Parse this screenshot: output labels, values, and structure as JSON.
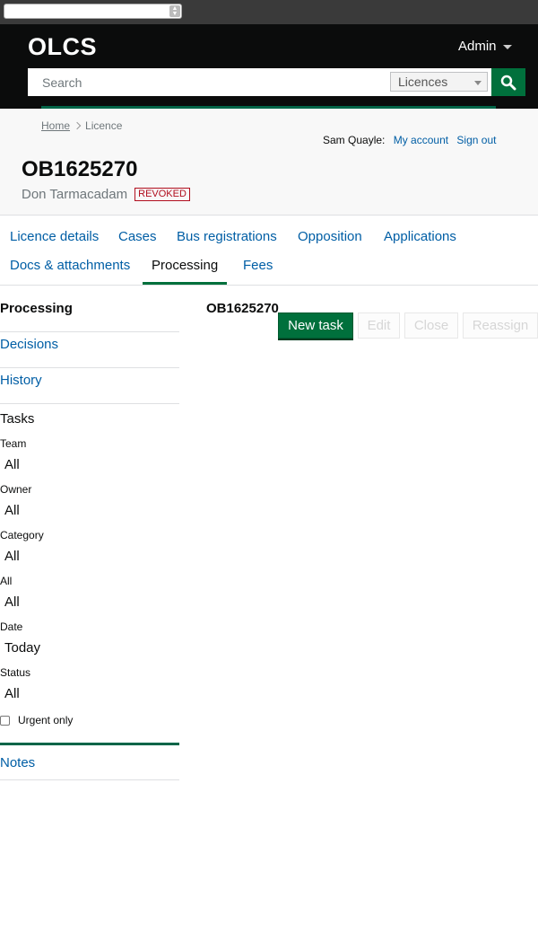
{
  "header": {
    "logo": "OLCS",
    "admin_label": "Admin",
    "search_placeholder": "Search",
    "search_scope": "Licences"
  },
  "breadcrumb": {
    "home": "Home",
    "current": "Licence"
  },
  "user": {
    "name": "Sam Quayle:",
    "my_account": "My account",
    "sign_out": "Sign out"
  },
  "licence": {
    "number": "OB1625270",
    "operator": "Don Tarmacadam",
    "status": "REVOKED"
  },
  "tabs": [
    {
      "label": "Licence details"
    },
    {
      "label": "Cases"
    },
    {
      "label": "Bus registrations"
    },
    {
      "label": "Opposition"
    },
    {
      "label": "Applications"
    },
    {
      "label": "Docs & attachments"
    },
    {
      "label": "Processing"
    },
    {
      "label": "Fees"
    }
  ],
  "sidebar": {
    "items": [
      {
        "label": "Processing"
      },
      {
        "label": "Decisions"
      },
      {
        "label": "History"
      }
    ],
    "tasks_heading": "Tasks",
    "filters": [
      {
        "label": "Team",
        "value": "All"
      },
      {
        "label": "Owner",
        "value": "All"
      },
      {
        "label": "Category",
        "value": "All"
      },
      {
        "label": "All",
        "value": "All"
      },
      {
        "label": "Date",
        "value": "Today"
      },
      {
        "label": "Status",
        "value": "All"
      }
    ],
    "urgent_label": "Urgent only",
    "notes": "Notes"
  },
  "main": {
    "title": "OB1625270",
    "buttons": {
      "new_task": "New task",
      "edit": "Edit",
      "close": "Close",
      "reassign": "Reassign"
    }
  },
  "colors": {
    "brand_green": "#00703c",
    "header_bg": "#0b0c0c",
    "link": "#005ea5",
    "revoked_red": "#b10e1e"
  }
}
